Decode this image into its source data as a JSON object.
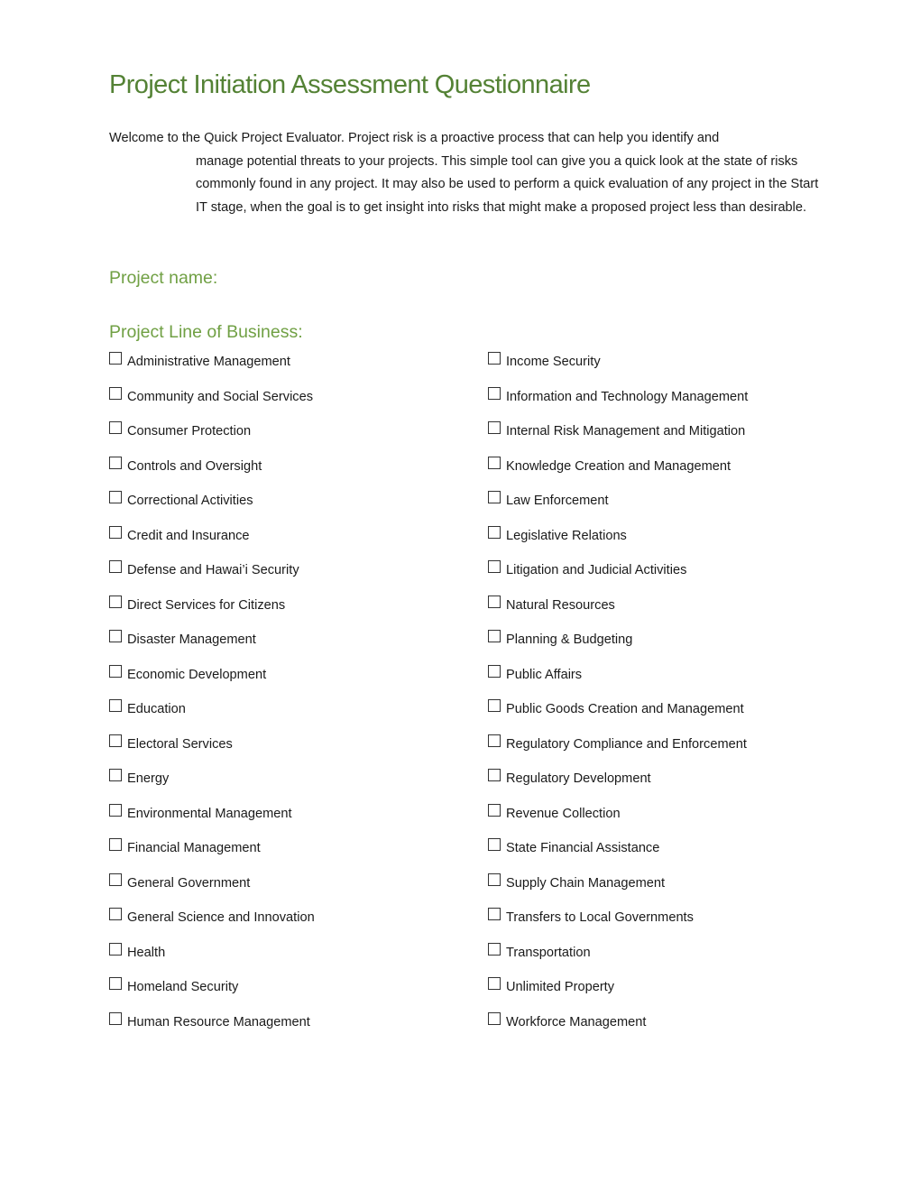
{
  "document": {
    "title": "Project Initiation Assessment Questionnaire",
    "intro": {
      "first_line": "Welcome to the Quick Project Evaluator. Project risk is a proactive process that can help you identify and",
      "continuation": "manage potential threats to your projects.  This simple tool can give you a quick look at the state of risks commonly found in any project.  It may also be used to perform a quick evaluation of any project in the Start IT stage, when the goal is to get insight into risks that might make a proposed project less than desirable."
    },
    "project_name_label": "Project name:",
    "line_of_business_label": "Project Line of Business:",
    "colors": {
      "title": "#548235",
      "heading": "#70a044"
    },
    "line_of_business": {
      "left_column": [
        {
          "label": "Administrative Management",
          "checked": false
        },
        {
          "label": "Community and Social Services",
          "checked": false
        },
        {
          "label": "Consumer Protection",
          "checked": false
        },
        {
          "label": "Controls and Oversight",
          "checked": false
        },
        {
          "label": "Correctional Activities",
          "checked": false
        },
        {
          "label": "Credit and Insurance",
          "checked": false
        },
        {
          "label": "Defense and Hawai’i Security",
          "checked": false
        },
        {
          "label": "Direct Services for Citizens",
          "checked": false
        },
        {
          "label": "Disaster Management",
          "checked": false
        },
        {
          "label": "Economic Development",
          "checked": false
        },
        {
          "label": "Education",
          "checked": false
        },
        {
          "label": "Electoral Services",
          "checked": false
        },
        {
          "label": "Energy",
          "checked": false
        },
        {
          "label": "Environmental Management",
          "checked": false
        },
        {
          "label": "Financial Management",
          "checked": false
        },
        {
          "label": "General Government",
          "checked": false
        },
        {
          "label": "General Science and Innovation",
          "checked": false
        },
        {
          "label": "Health",
          "checked": false
        },
        {
          "label": "Homeland Security",
          "checked": false
        },
        {
          "label": "Human Resource Management",
          "checked": false
        }
      ],
      "right_column": [
        {
          "label": "Income Security",
          "checked": false
        },
        {
          "label": "Information and Technology Management",
          "checked": false
        },
        {
          "label": "Internal Risk Management and Mitigation",
          "checked": false
        },
        {
          "label": "Knowledge Creation and Management",
          "checked": false
        },
        {
          "label": "Law Enforcement",
          "checked": false
        },
        {
          "label": "Legislative Relations",
          "checked": false
        },
        {
          "label": "Litigation and Judicial Activities",
          "checked": false
        },
        {
          "label": "Natural Resources",
          "checked": false
        },
        {
          "label": "Planning & Budgeting",
          "checked": false
        },
        {
          "label": "Public Affairs",
          "checked": false
        },
        {
          "label": "Public Goods Creation and Management",
          "checked": false
        },
        {
          "label": "Regulatory Compliance and Enforcement",
          "checked": false
        },
        {
          "label": "Regulatory Development",
          "checked": false
        },
        {
          "label": "Revenue Collection",
          "checked": false
        },
        {
          "label": "State Financial Assistance",
          "checked": false
        },
        {
          "label": "Supply Chain Management",
          "checked": false
        },
        {
          "label": "Transfers to Local Governments",
          "checked": false
        },
        {
          "label": "Transportation",
          "checked": false
        },
        {
          "label": "Unlimited Property",
          "checked": false
        },
        {
          "label": "Workforce Management",
          "checked": false
        }
      ]
    }
  }
}
